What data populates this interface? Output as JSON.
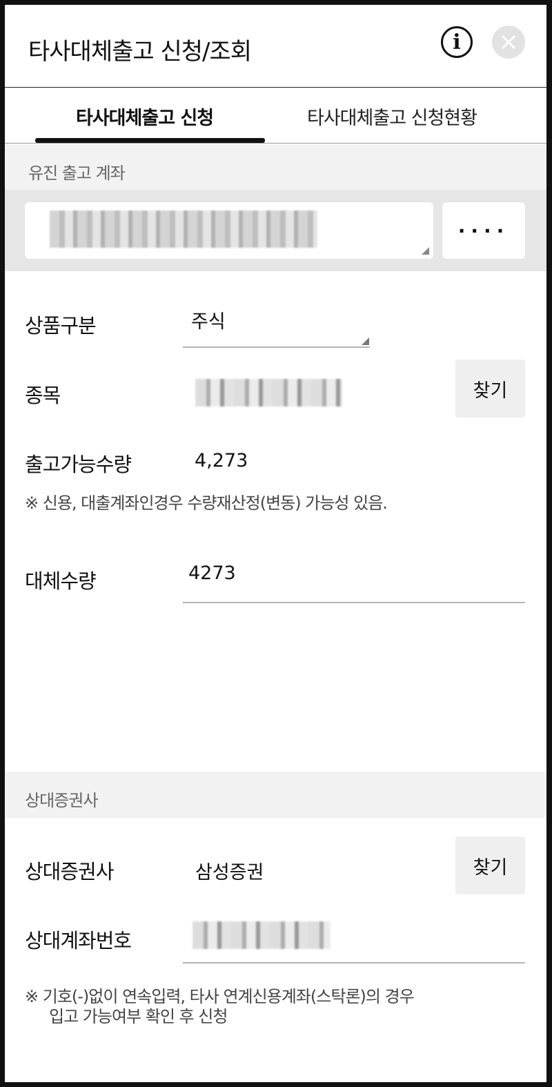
{
  "header": {
    "title": "타사대체출고 신청/조회",
    "info_icon": "i",
    "close_icon": "×"
  },
  "tabs": [
    {
      "label": "타사대체출고 신청",
      "active": true
    },
    {
      "label": "타사대체출고 신청현황",
      "active": false
    }
  ],
  "account_section": {
    "label": "유진 출고 계좌",
    "account_value": "",
    "more_label": "····"
  },
  "form": {
    "product_type": {
      "label": "상품구분",
      "value": "주식"
    },
    "item": {
      "label": "종목",
      "value": "",
      "find_label": "찾기"
    },
    "available_qty": {
      "label": "출고가능수량",
      "value": "4,273"
    },
    "note1": "※ 신용, 대출계좌인경우 수량재산정(변동) 가능성 있음.",
    "transfer_qty": {
      "label": "대체수량",
      "value": "4273"
    }
  },
  "counterparty_section": {
    "label": "상대증권사",
    "broker": {
      "label": "상대증권사",
      "value": "삼성증권",
      "find_label": "찾기"
    },
    "account_no": {
      "label": "상대계좌번호",
      "value": ""
    },
    "note2_line1": "※ 기호(-)없이 연속입력, 타사 연계신용계좌(스탁론)의 경우",
    "note2_line2": "입고 가능여부 확인 후 신청"
  },
  "colors": {
    "accent": "#111111",
    "section_bg": "#f2f2f2",
    "account_row_bg": "#e6e6e6",
    "button_bg": "#efefef"
  }
}
